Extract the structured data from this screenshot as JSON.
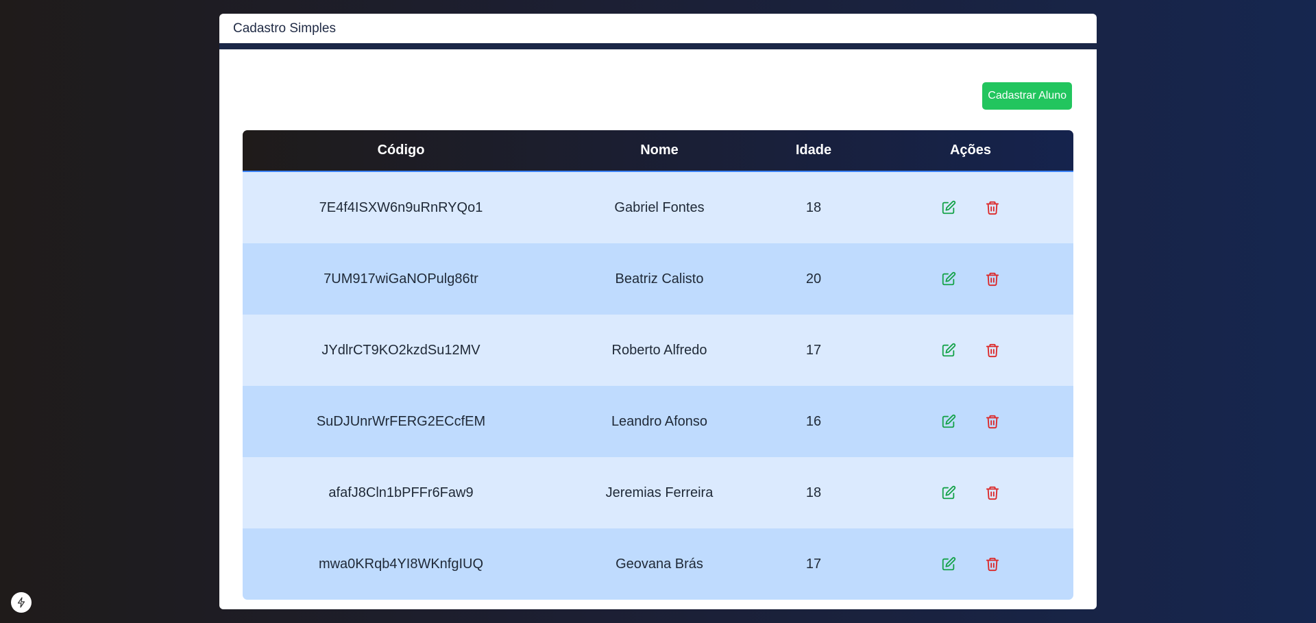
{
  "header": {
    "title": "Cadastro Simples"
  },
  "toolbar": {
    "add_label": "Cadastrar Aluno"
  },
  "table": {
    "columns": [
      "Código",
      "Nome",
      "Idade",
      "Ações"
    ],
    "rows": [
      {
        "codigo": "7E4f4ISXW6n9uRnRYQo1",
        "nome": "Gabriel Fontes",
        "idade": "18"
      },
      {
        "codigo": "7UM917wiGaNOPulg86tr",
        "nome": "Beatriz Calisto",
        "idade": "20"
      },
      {
        "codigo": "JYdlrCT9KO2kzdSu12MV",
        "nome": "Roberto Alfredo",
        "idade": "17"
      },
      {
        "codigo": "SuDJUnrWrFERG2ECcfEM",
        "nome": "Leandro Afonso",
        "idade": "16"
      },
      {
        "codigo": "afafJ8Cln1bPFFr6Faw9",
        "nome": "Jeremias Ferreira",
        "idade": "18"
      },
      {
        "codigo": "mwa0KRqb4YI8WKnfgIUQ",
        "nome": "Geovana Brás",
        "idade": "17"
      }
    ],
    "row_actions": [
      "edit-icon",
      "trash-icon"
    ]
  },
  "colors": {
    "accent_green": "#22c55e",
    "edit_icon": "#16a34a",
    "delete_icon": "#dc2626",
    "header_bg": "#1b2747",
    "row_light": "#dbeafe",
    "row_dark": "#bfdbfe"
  },
  "floating": {
    "icon": "bolt-icon"
  }
}
